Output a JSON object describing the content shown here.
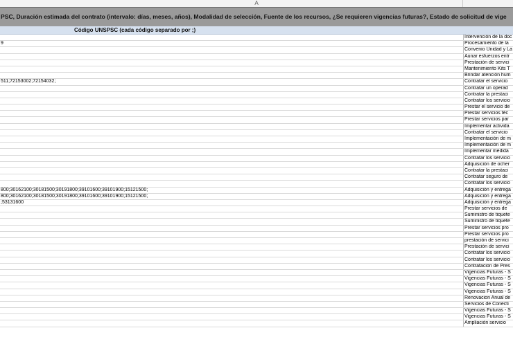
{
  "sheet": {
    "column_letter": "A",
    "banner_text": "PSC, Duración estimada del contrato (intervalo: días, meses, años), Modalidad de selección, Fuente de los recursos, ¿Se requieren vigencias futuras?, Estado de solicitud de vige",
    "subheader_label": "Código UNSPSC (cada código separado por ;)"
  },
  "rows": [
    {
      "a": "",
      "b": "Intervención de la doc"
    },
    {
      "a": "9",
      "b": "Procesamiento de la"
    },
    {
      "a": "",
      "b": "Convenio Unidad y La"
    },
    {
      "a": "",
      "b": "Aunar esfuerzos entr"
    },
    {
      "a": "",
      "b": "Prestación de servici"
    },
    {
      "a": "",
      "b": "Mantenimiento Kits T"
    },
    {
      "a": "",
      "b": "Brindar atención hum"
    },
    {
      "a": "511;72153002;72154032;",
      "b": "Contratar el servicio"
    },
    {
      "a": "",
      "b": "Contratar un operad"
    },
    {
      "a": "",
      "b": "Contratar la prestaci"
    },
    {
      "a": "",
      "b": "Contratar los servicio"
    },
    {
      "a": "",
      "b": "Prestar el servicio de"
    },
    {
      "a": "",
      "b": "Prestar servicios téc"
    },
    {
      "a": "",
      "b": "Prestar servicios par"
    },
    {
      "a": "",
      "b": "Implementar activida"
    },
    {
      "a": "",
      "b": "Contratar el servicio"
    },
    {
      "a": "",
      "b": "Implementación de m"
    },
    {
      "a": "",
      "b": "Implementación de m"
    },
    {
      "a": "",
      "b": "Implementar medida"
    },
    {
      "a": "",
      "b": "Contratar los servicio"
    },
    {
      "a": "",
      "b": "Adquisición de ocher"
    },
    {
      "a": "",
      "b": "Contratar la prestaci"
    },
    {
      "a": "",
      "b": "Contratar seguro de"
    },
    {
      "a": "",
      "b": "Contratar los servicio"
    },
    {
      "a": "800;30162100;30181500;30191800;39101600;39101900;15121500;",
      "b": "Adquisición y entrega"
    },
    {
      "a": "800;30162100;30181500;30191800;39101600;39101900;15121500;",
      "b": "Adquisición y entrega"
    },
    {
      "a": ";53131600",
      "b": "Adquisición y entrega"
    },
    {
      "a": "",
      "b": "Prestar servicios de"
    },
    {
      "a": "",
      "b": "Suministro de tiquete"
    },
    {
      "a": "",
      "b": "Suministro de tiquete"
    },
    {
      "a": "",
      "b": "Prestar servicios pro"
    },
    {
      "a": "",
      "b": "Prestar servicios pro"
    },
    {
      "a": "",
      "b": "prestación de servici"
    },
    {
      "a": "",
      "b": "Prestación de servici"
    },
    {
      "a": "",
      "b": "Contratar los servicio"
    },
    {
      "a": "",
      "b": "Contratar los servicio"
    },
    {
      "a": "",
      "b": "Contratacion de Pres"
    },
    {
      "a": "",
      "b": "Vigencias Futuras - S"
    },
    {
      "a": "",
      "b": "Vigencias Futuras - S"
    },
    {
      "a": "",
      "b": "Vigencias Futuras - S"
    },
    {
      "a": "",
      "b": "Vigencias Futuras - S"
    },
    {
      "a": "",
      "b": "Renovacion Anual de"
    },
    {
      "a": "",
      "b": "Servicios de Conecti"
    },
    {
      "a": "",
      "b": "Vigencias Futuras - S"
    },
    {
      "a": "",
      "b": "Vigencias Futuras - S"
    },
    {
      "a": "",
      "b": "Ampliación servicio"
    }
  ]
}
